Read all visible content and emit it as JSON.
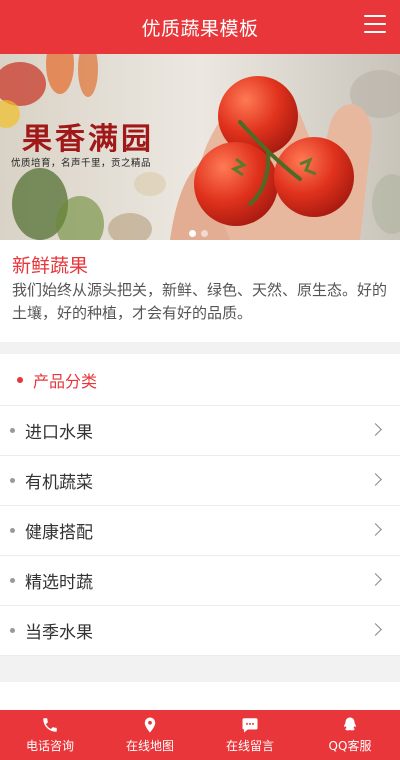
{
  "header": {
    "title": "优质蔬果模板",
    "menu_icon": "hamburger-menu-icon"
  },
  "banner": {
    "title": "果香满园",
    "subtitle": "优质培育，名声千里，贡之精品",
    "slide_count": 2,
    "active_slide": 1
  },
  "intro": {
    "title": "新鲜蔬果",
    "text": "我们始终从源头把关，新鲜、绿色、天然、原生态。好的土壤，好的种植，才会有好的品质。"
  },
  "categories": {
    "title": "产品分类",
    "items": [
      {
        "label": "进口水果"
      },
      {
        "label": "有机蔬菜"
      },
      {
        "label": "健康搭配"
      },
      {
        "label": "精选时蔬"
      },
      {
        "label": "当季水果"
      }
    ]
  },
  "footer": {
    "items": [
      {
        "label": "电话咨询",
        "icon": "phone-icon"
      },
      {
        "label": "在线地图",
        "icon": "map-pin-icon"
      },
      {
        "label": "在线留言",
        "icon": "chat-bubble-icon"
      },
      {
        "label": "QQ客服",
        "icon": "qq-icon"
      }
    ]
  },
  "colors": {
    "primary": "#e8363a",
    "text": "#333333",
    "muted": "#555555"
  }
}
